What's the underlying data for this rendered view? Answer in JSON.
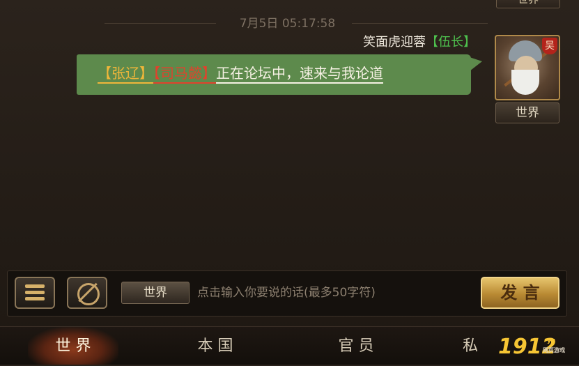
{
  "top_badge": "世界",
  "chat": {
    "timestamp": "7月5日 05:17:58",
    "messages": [
      {
        "sender": "笑面虎迎蓉",
        "rank": "【伍长】",
        "hero1": "【张辽】",
        "hero2": "【司马懿】",
        "text": "正在论坛中，速来与我论道",
        "faction": "吴",
        "channel": "世界"
      }
    ]
  },
  "input_bar": {
    "channel": "世界",
    "placeholder": "点击输入你要说的话(最多50字符)",
    "value": "",
    "send_label": "发 言"
  },
  "tabs": [
    {
      "label": "世 界",
      "active": true
    },
    {
      "label": "本 国",
      "active": false
    },
    {
      "label": "官 员",
      "active": false
    },
    {
      "label": "私",
      "active": false
    }
  ],
  "watermark": {
    "text": "1912",
    "tag": "yx",
    "sub": "网页游戏"
  },
  "colors": {
    "bubble": "#5d8a4c",
    "hero1": "#f0b63a",
    "hero2": "#e2412c",
    "rank": "#4ec14e",
    "send_button": "#d8b057"
  }
}
